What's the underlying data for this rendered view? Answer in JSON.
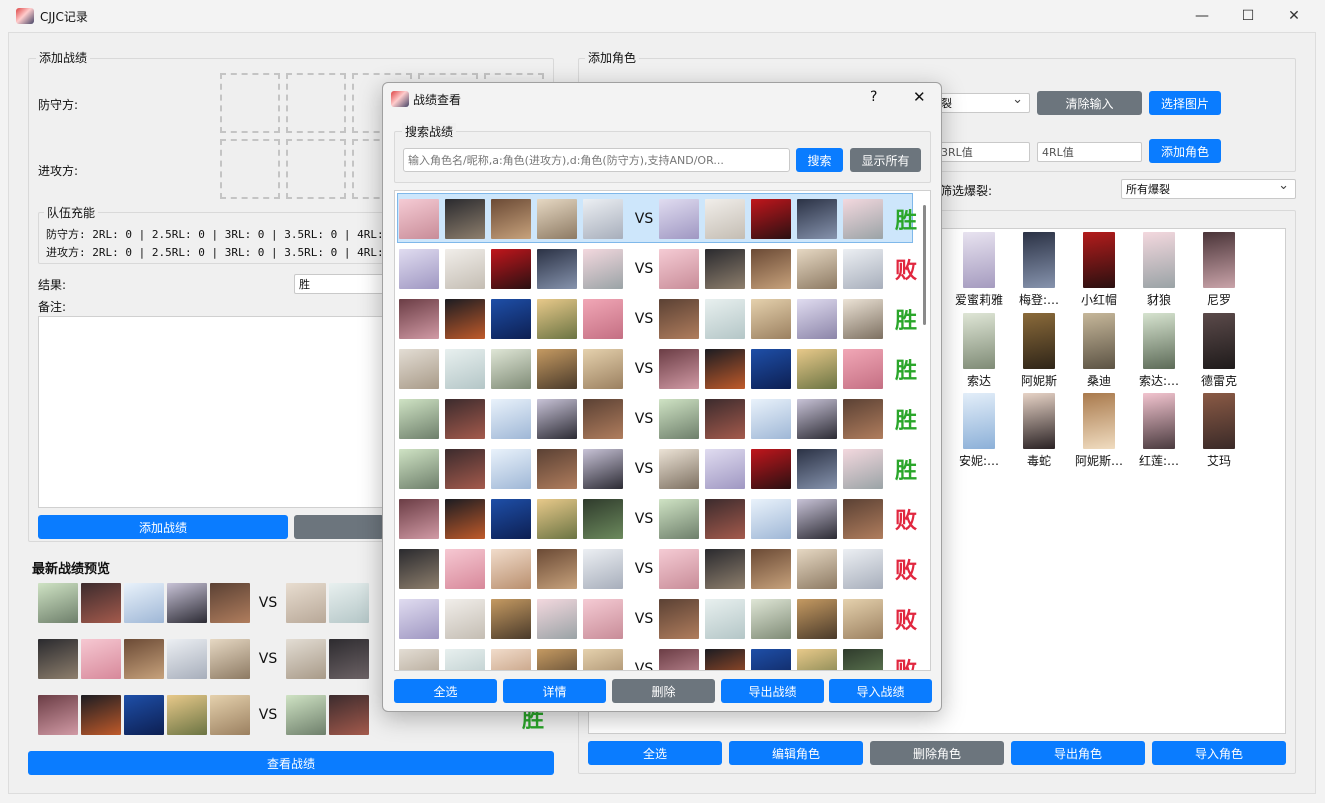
{
  "window": {
    "title": "CJJC记录",
    "minimize": "—",
    "maximize": "☐",
    "close": "✕"
  },
  "add_record": {
    "group_title": "添加战绩",
    "defender_label": "防守方:",
    "attacker_label": "进攻方:",
    "team_charge": {
      "title": "队伍充能",
      "defender_line": "防守方: 2RL: 0 | 2.5RL: 0 | 3RL: 0 | 3.5RL: 0 | 4RL: 0",
      "attacker_line": "进攻方: 2RL: 0 | 2.5RL: 0 | 3RL: 0 | 3.5RL: 0 | 4RL: 0"
    },
    "result_label": "结果:",
    "result_value": "胜",
    "note_label": "备注:",
    "add_button": "添加战绩"
  },
  "preview": {
    "title": "最新战绩预览",
    "vs": "VS",
    "visible_result": "胜",
    "view_button": "查看战绩"
  },
  "add_character": {
    "group_title": "添加角色",
    "burst_combo": "裂",
    "clear_button": "清除输入",
    "choose_image_button": "选择图片",
    "rl3_placeholder": "3RL值",
    "rl4_placeholder": "4RL值",
    "add_button": "添加角色",
    "filter_label": "筛选爆裂:",
    "filter_value": "所有爆裂",
    "characters": [
      [
        "爱蜜莉雅",
        "梅登:…",
        "小红帽",
        "豺狼",
        "尼罗"
      ],
      [
        "索达",
        "阿妮斯",
        "桑迪",
        "索达:…",
        "德雷克"
      ],
      [
        "安妮:…",
        "毒蛇",
        "阿妮斯…",
        "红莲:…",
        "艾玛"
      ]
    ],
    "buttons": {
      "select_all": "全选",
      "edit": "编辑角色",
      "delete": "删除角色",
      "export": "导出角色",
      "import": "导入角色"
    }
  },
  "dialog": {
    "title": "战绩查看",
    "help": "?",
    "close": "✕",
    "search_group": "搜索战绩",
    "search_placeholder": "输入角色名/昵称,a:角色(进攻方),d:角色(防守方),支持AND/OR...",
    "search_button": "搜索",
    "show_all_button": "显示所有",
    "vs": "VS",
    "results": [
      "胜",
      "败",
      "胜",
      "胜",
      "胜",
      "胜",
      "败",
      "败",
      "败",
      "败"
    ],
    "buttons": {
      "select_all": "全选",
      "details": "详情",
      "delete": "删除",
      "export": "导出战绩",
      "import": "导入战绩"
    }
  }
}
